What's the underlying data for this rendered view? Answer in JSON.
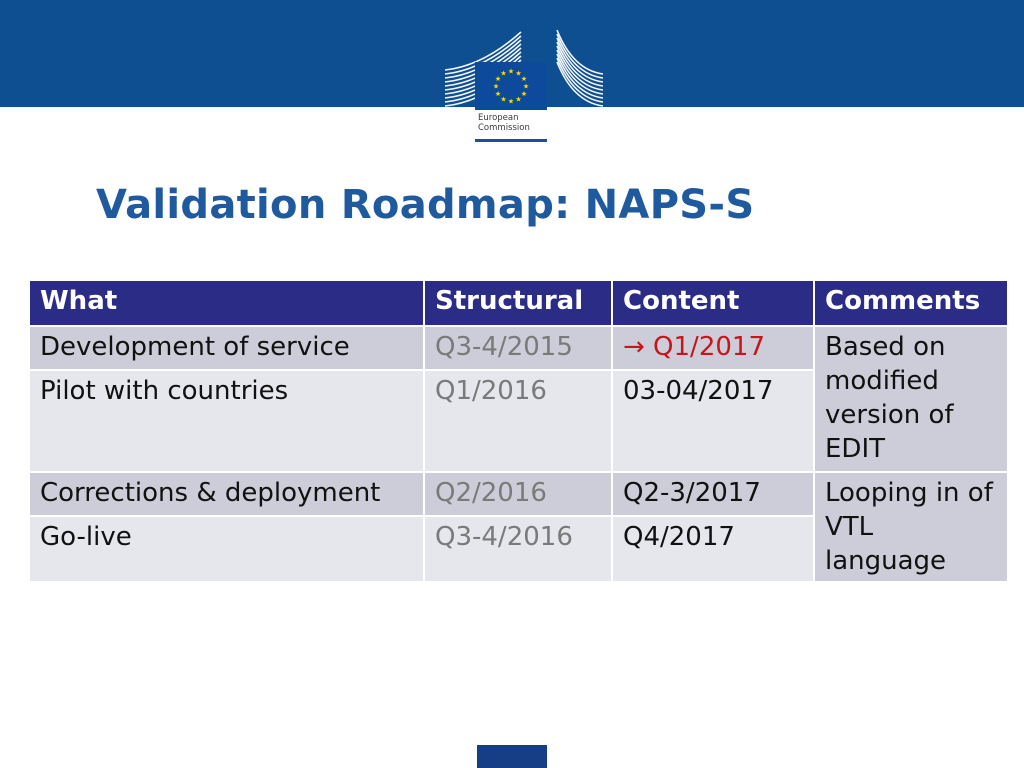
{
  "header": {
    "logo_label_line1": "European",
    "logo_label_line2": "Commission",
    "colors": {
      "band": "#0e4f91",
      "title": "#1f5a9e",
      "table_header": "#2b2c86",
      "highlight": "#c8151b"
    }
  },
  "title": "Validation Roadmap: NAPS-S",
  "table": {
    "headers": [
      "What",
      "Structural",
      "Content",
      "Comments"
    ],
    "rows": [
      {
        "what": "Development of service",
        "structural": "Q3-4/2015",
        "content": "→ Q1/2017",
        "content_highlight": true
      },
      {
        "what": "Pilot with countries",
        "structural": "Q1/2016",
        "content": "03-04/2017"
      },
      {
        "what": "Corrections & deployment",
        "structural": "Q2/2016",
        "content": "Q2-3/2017"
      },
      {
        "what": "Go-live",
        "structural": "Q3-4/2016",
        "content": "Q4/2017"
      }
    ],
    "comments": [
      "Based on modified version of EDIT",
      "Looping in of VTL language"
    ]
  }
}
